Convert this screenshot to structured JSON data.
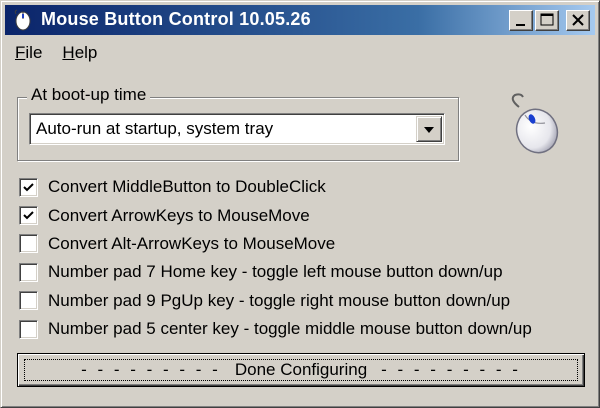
{
  "window": {
    "title": "Mouse Button Control 10.05.26",
    "icon": "mouse-icon",
    "controls": [
      "minimize-icon",
      "maximize-icon",
      "close-icon"
    ]
  },
  "menubar": {
    "items": [
      {
        "label_ul": "F",
        "label_rest": "ile"
      },
      {
        "label_ul": "H",
        "label_rest": "elp"
      }
    ]
  },
  "boot": {
    "group_label": "At boot-up time",
    "selected": "Auto-run at startup, system tray"
  },
  "options": [
    {
      "label": "Convert MiddleButton to DoubleClick",
      "checked": true
    },
    {
      "label": "Convert ArrowKeys to MouseMove",
      "checked": true
    },
    {
      "label": "Convert Alt-ArrowKeys to MouseMove",
      "checked": false
    },
    {
      "label": "Number pad 7 Home key - toggle left mouse button down/up",
      "checked": false
    },
    {
      "label": "Number pad 9 PgUp key - toggle right mouse button down/up",
      "checked": false
    },
    {
      "label": "Number pad 5 center key - toggle middle mouse button down/up",
      "checked": false
    }
  ],
  "done_button": {
    "dashes_left": "- - - - - - - - -",
    "label": "Done Configuring",
    "dashes_right": "- - - - - - - - -"
  },
  "colors": {
    "title_active": "#0a246a",
    "face": "#d4d0c8"
  }
}
